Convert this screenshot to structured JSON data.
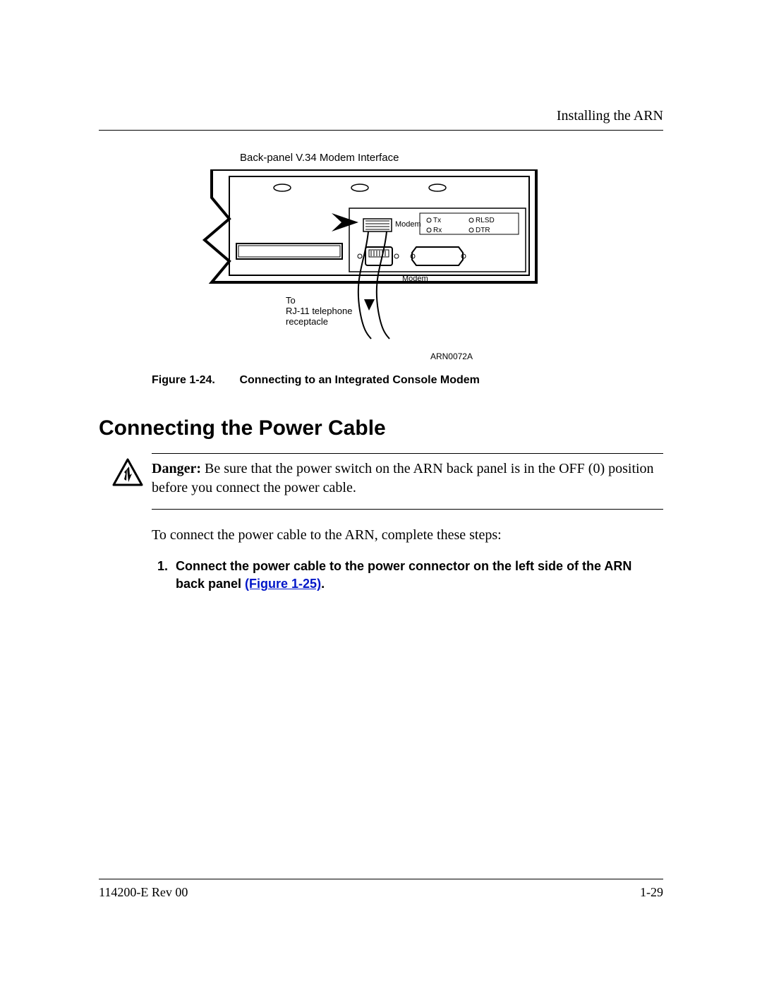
{
  "running_head": "Installing the ARN",
  "figure": {
    "title_above": "Back-panel V.34 Modem Interface",
    "labels": {
      "modem_text": "Modem",
      "modem_text2": "Modem",
      "tx": "Tx",
      "rx": "Rx",
      "rlsd": "RLSD",
      "dtr": "DTR",
      "cable_to_line1": "To",
      "cable_to_line2": "RJ-11 telephone",
      "cable_to_line3": "receptacle"
    },
    "ref_number": "ARN0072A",
    "caption_num": "Figure 1-24.",
    "caption_text": "Connecting to an Integrated Console Modem"
  },
  "section_heading": "Connecting the Power Cable",
  "warning": {
    "lead": "Danger:",
    "body": " Be sure that the power switch on the ARN back panel is in the OFF (0) position before you connect the power cable."
  },
  "intro_text": "To connect the power cable to the ARN, complete these steps:",
  "step1": {
    "text_before_link": "Connect the power cable to the power connector on the left side of the ARN back panel ",
    "link_text": "(Figure 1-25)",
    "text_after_link": "."
  },
  "footer": {
    "left": "114200-E Rev 00",
    "right": "1-29"
  }
}
